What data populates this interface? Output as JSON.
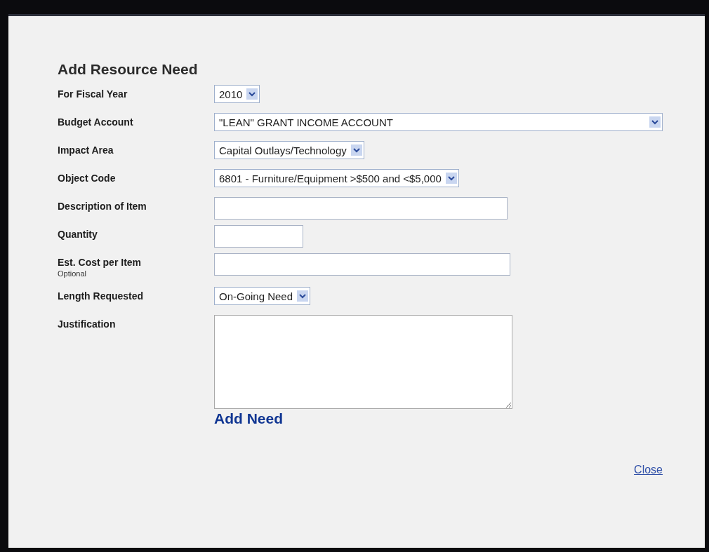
{
  "title": "Add Resource Need",
  "fields": [
    {
      "label": "For Fiscal Year",
      "kind": "select",
      "value": "2010"
    },
    {
      "label": "Budget Account",
      "kind": "select",
      "value": "\"LEAN\" GRANT INCOME ACCOUNT"
    },
    {
      "label": "Impact Area",
      "kind": "select",
      "value": "Capital Outlays/Technology"
    },
    {
      "label": "Object Code",
      "kind": "select",
      "value": "6801 - Furniture/Equipment >$500 and <$5,000"
    },
    {
      "label": "Description of Item",
      "kind": "text"
    },
    {
      "label": "Quantity",
      "kind": "text"
    },
    {
      "label": "Est. Cost per Item",
      "note": "Optional",
      "kind": "text"
    },
    {
      "label": "Length Requested",
      "kind": "select",
      "value": "On-Going Need"
    },
    {
      "label": "Justification",
      "kind": "textarea"
    }
  ],
  "submit": "Add Need",
  "close": "Close"
}
